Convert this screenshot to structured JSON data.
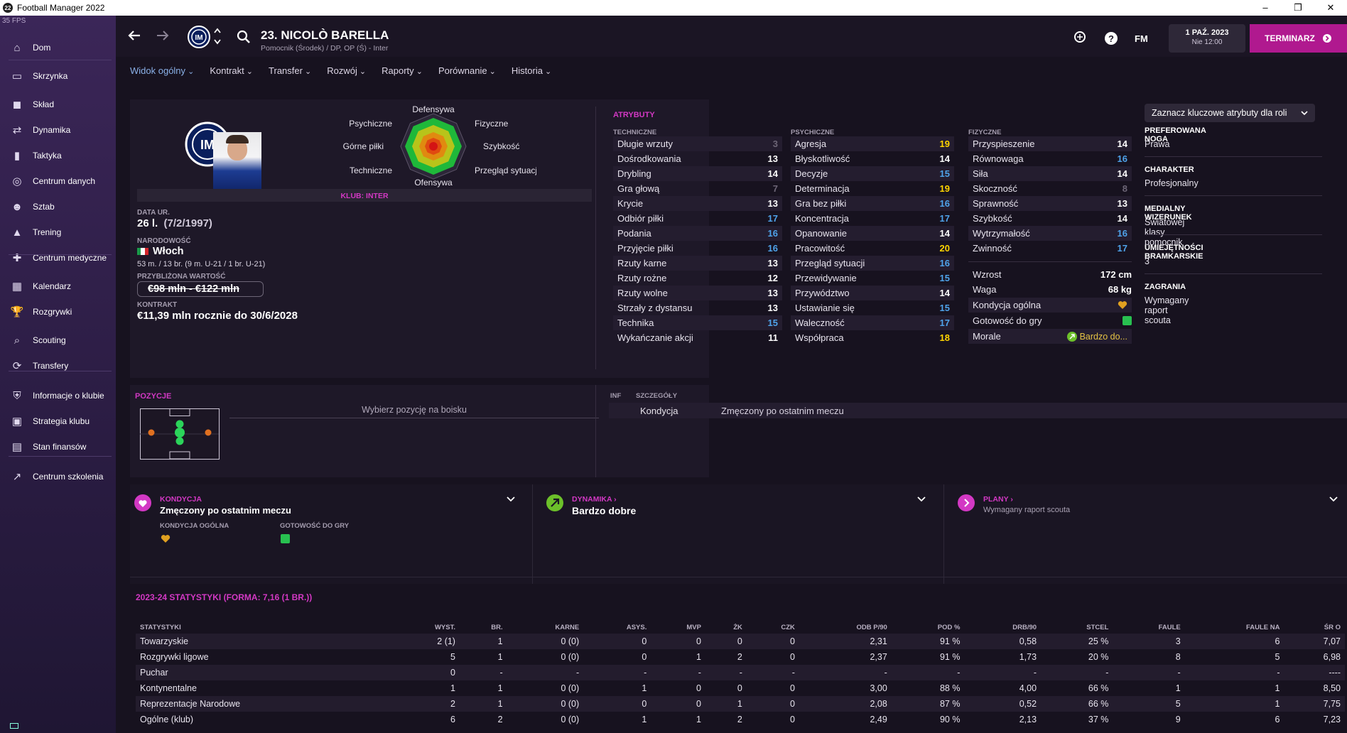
{
  "window": {
    "title": "Football Manager 2022",
    "logo": "22",
    "fps": "35 FPS"
  },
  "sidebar": {
    "items": [
      {
        "label": "Dom",
        "icon": "home-icon"
      },
      {
        "label": "Skrzynka",
        "icon": "inbox-icon"
      },
      {
        "label": "Skład",
        "icon": "shirt-icon"
      },
      {
        "label": "Dynamika",
        "icon": "dynamics-icon"
      },
      {
        "label": "Taktyka",
        "icon": "tactics-icon"
      },
      {
        "label": "Centrum danych",
        "icon": "data-icon"
      },
      {
        "label": "Sztab",
        "icon": "staff-icon"
      },
      {
        "label": "Trening",
        "icon": "training-icon"
      },
      {
        "label": "Centrum medyczne",
        "icon": "medical-icon"
      },
      {
        "label": "Kalendarz",
        "icon": "calendar-icon"
      },
      {
        "label": "Rozgrywki",
        "icon": "trophy-icon"
      },
      {
        "label": "Scouting",
        "icon": "scouting-icon"
      },
      {
        "label": "Transfery",
        "icon": "transfers-icon"
      },
      {
        "label": "Informacje o klubie",
        "icon": "club-info-icon"
      },
      {
        "label": "Strategia klubu",
        "icon": "strategy-icon"
      },
      {
        "label": "Stan finansów",
        "icon": "finance-icon"
      },
      {
        "label": "Centrum szkolenia",
        "icon": "coaching-icon"
      }
    ]
  },
  "header": {
    "name": "23. NICOLÒ BARELLA",
    "sub": "Pomocnik (Środek) / DP, OP (Ś) - Inter",
    "fm": "FM",
    "date": "1 PAŹ. 2023",
    "time": "Nie 12:00",
    "continue": "TERMINARZ"
  },
  "tabs": [
    "Widok ogólny",
    "Kontrakt",
    "Transfer",
    "Rozwój",
    "Raporty",
    "Porównanie",
    "Historia"
  ],
  "profile": {
    "club_label": "KLUB: INTER",
    "dob_label": "DATA UR.",
    "age": "26 l.",
    "dob": "(7/2/1997)",
    "nat_label": "NARODOWOŚĆ",
    "nationality": "Włoch",
    "caps": "53 m. / 13 br. (9 m. U-21 / 1 br. U-21)",
    "value_label": "PRZYBLIŻONA WARTOŚĆ",
    "value": "€98 mln - €122 mln",
    "contract_label": "KONTRAKT",
    "contract": "€11,39 mln rocznie do 30/6/2028"
  },
  "radar": {
    "labels": {
      "top": "Defensywa",
      "topleft": "Psychiczne",
      "topright": "Fizyczne",
      "left": "Górne piłki",
      "right": "Szybkość",
      "bottomleft": "Techniczne",
      "bottomright": "Przegląd sytuacji",
      "bottom": "Ofensywa"
    }
  },
  "attributes": {
    "title": "ATRYBUTY",
    "tech_label": "TECHNICZNE",
    "mental_label": "PSYCHICZNE",
    "phys_label": "FIZYCZNE",
    "technical": [
      [
        "Długie wrzuty",
        "3"
      ],
      [
        "Dośrodkowania",
        "13"
      ],
      [
        "Drybling",
        "14"
      ],
      [
        "Gra głową",
        "7"
      ],
      [
        "Krycie",
        "13"
      ],
      [
        "Odbiór piłki",
        "17"
      ],
      [
        "Podania",
        "16"
      ],
      [
        "Przyjęcie piłki",
        "16"
      ],
      [
        "Rzuty karne",
        "13"
      ],
      [
        "Rzuty rożne",
        "12"
      ],
      [
        "Rzuty wolne",
        "13"
      ],
      [
        "Strzały z dystansu",
        "13"
      ],
      [
        "Technika",
        "15"
      ],
      [
        "Wykańczanie akcji",
        "11"
      ]
    ],
    "mental": [
      [
        "Agresja",
        "19"
      ],
      [
        "Błyskotliwość",
        "14"
      ],
      [
        "Decyzje",
        "15"
      ],
      [
        "Determinacja",
        "19"
      ],
      [
        "Gra bez piłki",
        "16"
      ],
      [
        "Koncentracja",
        "17"
      ],
      [
        "Opanowanie",
        "14"
      ],
      [
        "Pracowitość",
        "20"
      ],
      [
        "Przegląd sytuacji",
        "16"
      ],
      [
        "Przewidywanie",
        "15"
      ],
      [
        "Przywództwo",
        "14"
      ],
      [
        "Ustawianie się",
        "15"
      ],
      [
        "Waleczność",
        "17"
      ],
      [
        "Współpraca",
        "18"
      ]
    ],
    "physical": [
      [
        "Przyspieszenie",
        "14"
      ],
      [
        "Równowaga",
        "16"
      ],
      [
        "Siła",
        "14"
      ],
      [
        "Skoczność",
        "8"
      ],
      [
        "Sprawność",
        "13"
      ],
      [
        "Szybkość",
        "14"
      ],
      [
        "Wytrzymałość",
        "16"
      ],
      [
        "Zwinność",
        "17"
      ]
    ],
    "height_label": "Wzrost",
    "height": "172 cm",
    "weight_label": "Waga",
    "weight": "68 kg",
    "cond_label": "Kondycja ogólna",
    "ready_label": "Gotowość do gry",
    "morale_label": "Morale",
    "morale": "Bardzo do..."
  },
  "colors": {
    "accent": "#d338c4",
    "white_val": "#ffffff",
    "blue_val": "#4fa3ea",
    "yellow_val": "#ffd400",
    "grey_val": "#6d6677"
  },
  "side_info": {
    "dropdown": "Zaznacz kluczowe atrybuty dla roli",
    "items": [
      {
        "label": "PREFEROWANA NOGA",
        "value": "Prawa"
      },
      {
        "label": "CHARAKTER",
        "value": "Profesjonalny"
      },
      {
        "label": "MEDIALNY WIZERUNEK",
        "value": "Światowej klasy pomocnik"
      },
      {
        "label": "UMIEJĘTNOŚCI BRAMKARSKIE",
        "value": "3"
      },
      {
        "label": "ZAGRANIA",
        "value": "Wymagany raport scouta"
      }
    ]
  },
  "positions": {
    "title": "POZYCJE",
    "hint": "Wybierz pozycję na boisku"
  },
  "details": {
    "col1": "INF",
    "col2": "SZCZEGÓŁY",
    "row_label": "Kondycja",
    "row_value": "Zmęczony po ostatnim meczu"
  },
  "cards": {
    "cond": {
      "title": "KONDYCJA",
      "value": "Zmęczony po ostatnim meczu",
      "sub1": "KONDYCJA OGÓLNA",
      "sub2": "GOTOWOŚĆ DO GRY"
    },
    "dyn": {
      "title": "DYNAMIKA ›",
      "value": "Bardzo dobre"
    },
    "plans": {
      "title": "PLANY ›",
      "value": "Wymagany raport scouta"
    }
  },
  "stats": {
    "title": "2023-24 STATYSTYKI (FORMA: 7,16 (1 BR.))",
    "headers": [
      "STATYSTYKI",
      "WYST.",
      "BR.",
      "KARNE",
      "ASYS.",
      "MVP",
      "ŻK",
      "CZK",
      "ODB P/90",
      "POD %",
      "DRB/90",
      "STCEL",
      "FAULE",
      "FAULE NA",
      "ŚR O"
    ],
    "rows": [
      [
        "Towarzyskie",
        "2 (1)",
        "1",
        "0 (0)",
        "0",
        "0",
        "0",
        "0",
        "2,31",
        "91 %",
        "0,58",
        "25 %",
        "3",
        "6",
        "7,07"
      ],
      [
        "Rozgrywki ligowe",
        "5",
        "1",
        "0 (0)",
        "0",
        "1",
        "2",
        "0",
        "2,37",
        "91 %",
        "1,73",
        "20 %",
        "8",
        "5",
        "6,98"
      ],
      [
        "Puchar",
        "0",
        "-",
        "-",
        "-",
        "-",
        "-",
        "-",
        "-",
        "-",
        "-",
        "-",
        "-",
        "-",
        "----"
      ],
      [
        "Kontynentalne",
        "1",
        "1",
        "0 (0)",
        "1",
        "0",
        "0",
        "0",
        "3,00",
        "88 %",
        "4,00",
        "66 %",
        "1",
        "1",
        "8,50"
      ],
      [
        "Reprezentacje Narodowe",
        "2",
        "1",
        "0 (0)",
        "0",
        "0",
        "1",
        "0",
        "2,08",
        "87 %",
        "0,52",
        "66 %",
        "5",
        "1",
        "7,75"
      ],
      [
        "Ogólne (klub)",
        "6",
        "2",
        "0 (0)",
        "1",
        "1",
        "2",
        "0",
        "2,49",
        "90 %",
        "2,13",
        "37 %",
        "9",
        "6",
        "7,23"
      ]
    ]
  }
}
